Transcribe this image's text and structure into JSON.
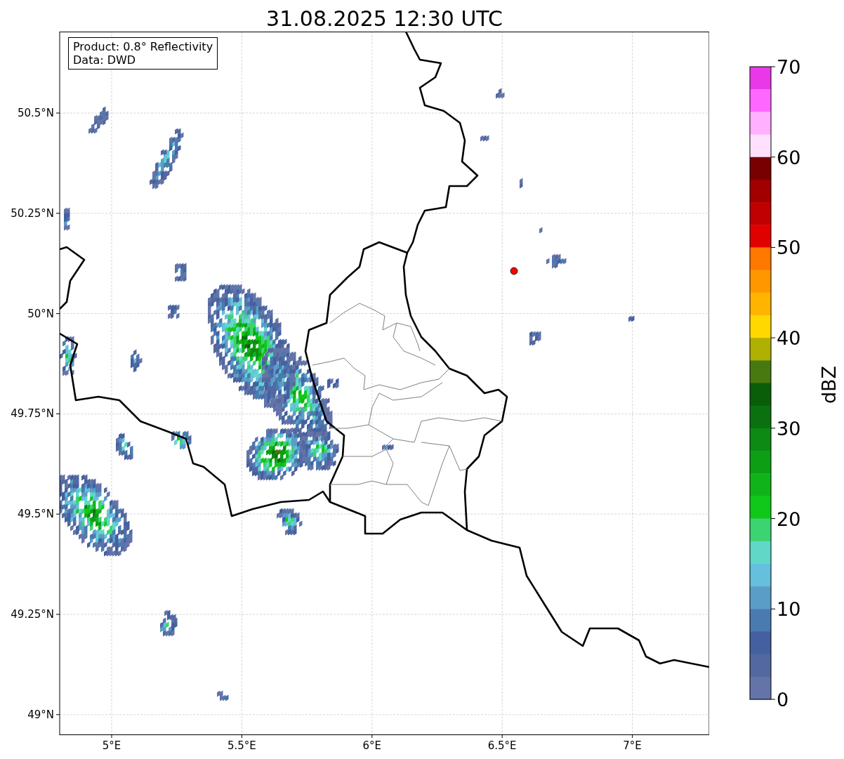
{
  "title": "31.08.2025 12:30 UTC",
  "info_box": [
    "Product: 0.8° Reflectivity",
    "Data: DWD"
  ],
  "map": {
    "xticks": [
      "5°E",
      "5.5°E",
      "6°E",
      "6.5°E",
      "7°E"
    ],
    "yticks": [
      "50.5°N",
      "50.25°N",
      "50°N",
      "49.75°N",
      "49.5°N",
      "49.25°N",
      "49°N"
    ]
  },
  "colorbar": {
    "label": "dBZ",
    "ticks": [
      "70",
      "60",
      "50",
      "40",
      "30",
      "20",
      "10",
      "0"
    ],
    "bands": [
      {
        "color": "#e838e8"
      },
      {
        "color": "#ff68ff"
      },
      {
        "color": "#ffb0ff"
      },
      {
        "color": "#ffe0ff"
      },
      {
        "color": "#780000"
      },
      {
        "color": "#a00000"
      },
      {
        "color": "#c00000"
      },
      {
        "color": "#e00000"
      },
      {
        "color": "#ff7800"
      },
      {
        "color": "#ff9800"
      },
      {
        "color": "#ffb400"
      },
      {
        "color": "#ffd800"
      },
      {
        "color": "#b0b000"
      },
      {
        "color": "#487810"
      },
      {
        "color": "#0a5e0a"
      },
      {
        "color": "#0a7010"
      },
      {
        "color": "#0c8a14"
      },
      {
        "color": "#0c9e14"
      },
      {
        "color": "#10b418"
      },
      {
        "color": "#10c818"
      },
      {
        "color": "#3cd470"
      },
      {
        "color": "#60d8c8"
      },
      {
        "color": "#64c0dc"
      },
      {
        "color": "#5a9ec8"
      },
      {
        "color": "#4a7ab0"
      },
      {
        "color": "#4460a0"
      },
      {
        "color": "#5468a0"
      },
      {
        "color": "#6474a8"
      }
    ]
  }
}
